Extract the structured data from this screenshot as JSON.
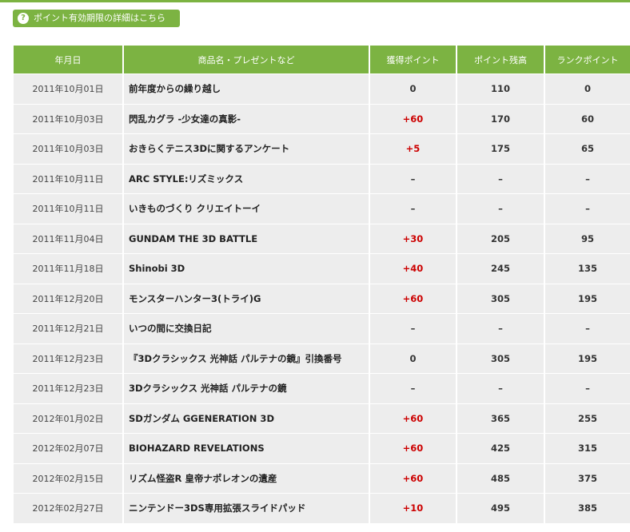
{
  "info_button": {
    "icon": "question-icon",
    "icon_glyph": "?",
    "label": "ポイント有効期限の詳細はこちら"
  },
  "table": {
    "headers": [
      "年月日",
      "商品名・プレゼントなど",
      "獲得ポイント",
      "ポイント残高",
      "ランクポイント"
    ],
    "rows": [
      {
        "date": "2011年10月01日",
        "name": "前年度からの繰り越し",
        "earned": "0",
        "balance": "110",
        "rank": "0"
      },
      {
        "date": "2011年10月03日",
        "name": "閃乱カグラ -少女達の真影-",
        "earned": "+60",
        "balance": "170",
        "rank": "60"
      },
      {
        "date": "2011年10月03日",
        "name": "おきらくテニス3Dに関するアンケート",
        "earned": "+5",
        "balance": "175",
        "rank": "65"
      },
      {
        "date": "2011年10月11日",
        "name": "ARC STYLE:リズミックス",
        "earned": "–",
        "balance": "–",
        "rank": "–"
      },
      {
        "date": "2011年10月11日",
        "name": "いきものづくり クリエイトーイ",
        "earned": "–",
        "balance": "–",
        "rank": "–"
      },
      {
        "date": "2011年11月04日",
        "name": "GUNDAM THE 3D BATTLE",
        "earned": "+30",
        "balance": "205",
        "rank": "95"
      },
      {
        "date": "2011年11月18日",
        "name": "Shinobi 3D",
        "earned": "+40",
        "balance": "245",
        "rank": "135"
      },
      {
        "date": "2011年12月20日",
        "name": "モンスターハンター3(トライ)G",
        "earned": "+60",
        "balance": "305",
        "rank": "195"
      },
      {
        "date": "2011年12月21日",
        "name": "いつの間に交換日記",
        "earned": "–",
        "balance": "–",
        "rank": "–"
      },
      {
        "date": "2011年12月23日",
        "name": "『3Dクラシックス 光神話 パルテナの鏡』引換番号",
        "earned": "0",
        "balance": "305",
        "rank": "195"
      },
      {
        "date": "2011年12月23日",
        "name": "3Dクラシックス 光神話 パルテナの鏡",
        "earned": "–",
        "balance": "–",
        "rank": "–"
      },
      {
        "date": "2012年01月02日",
        "name": "SDガンダム GGENERATION 3D",
        "earned": "+60",
        "balance": "365",
        "rank": "255"
      },
      {
        "date": "2012年02月07日",
        "name": "BIOHAZARD REVELATIONS",
        "earned": "+60",
        "balance": "425",
        "rank": "315"
      },
      {
        "date": "2012年02月15日",
        "name": "リズム怪盗R 皇帝ナポレオンの遺産",
        "earned": "+60",
        "balance": "485",
        "rank": "375"
      },
      {
        "date": "2012年02月27日",
        "name": "ニンテンドー3DS専用拡張スライドパッド",
        "earned": "+10",
        "balance": "495",
        "rank": "385"
      }
    ]
  },
  "colors": {
    "accent": "#7cb342",
    "row_bg": "#ededed",
    "positive": "#cc0000"
  }
}
